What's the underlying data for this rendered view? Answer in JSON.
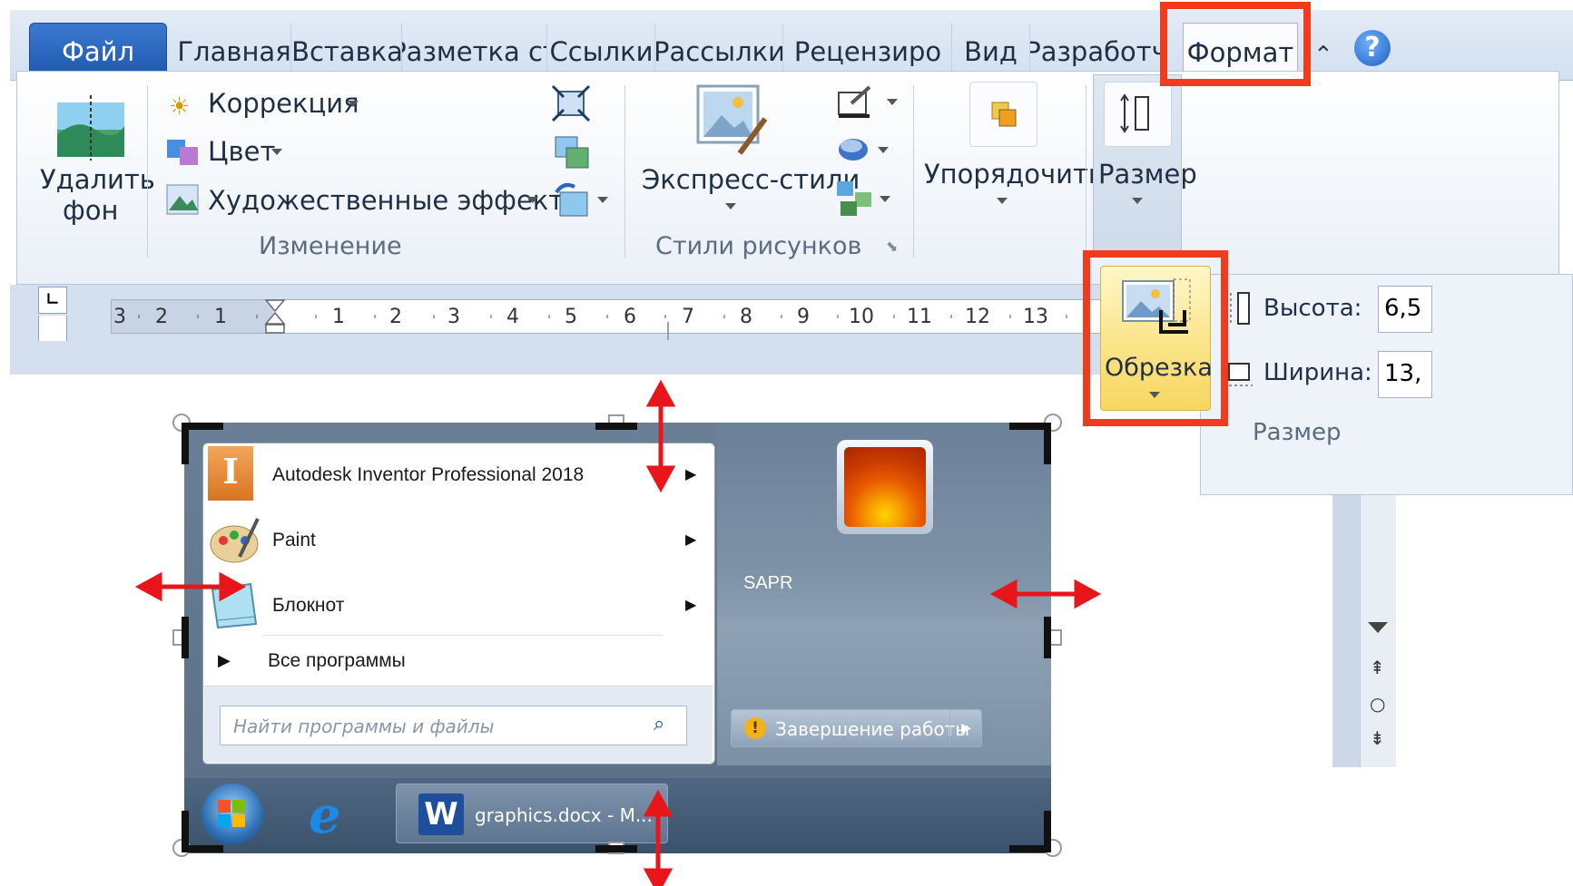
{
  "tabs": {
    "file": "Файл",
    "home": "Главная",
    "insert": "Вставка",
    "layout": "Разметка ст",
    "references": "Ссылки",
    "mailings": "Рассылки",
    "review": "Рецензиро",
    "view": "Вид",
    "developer": "Разработч",
    "format": "Формат"
  },
  "ribbon": {
    "remove_bg_line1": "Удалить",
    "remove_bg_line2": "фон",
    "correction": "Коррекция",
    "color": "Цвет",
    "artistic_effects": "Художественные эффекты",
    "group_adjust": "Изменение",
    "quick_styles": "Экспресс-стили",
    "group_picture_styles": "Стили рисунков",
    "arrange": "Упорядочить",
    "size": "Размер"
  },
  "ruler": {
    "numbers": [
      "3",
      "2",
      "1",
      "1",
      "2",
      "3",
      "4",
      "5",
      "6",
      "7",
      "8",
      "9",
      "10",
      "11",
      "12",
      "13"
    ]
  },
  "size_popout": {
    "crop": "Обрезка",
    "height_label": "Высота:",
    "height_value": "6,5",
    "width_label": "Ширина:",
    "width_value": "13,",
    "group_label": "Размер"
  },
  "start_menu": {
    "items": [
      {
        "label": "Autodesk Inventor Professional 2018"
      },
      {
        "label": "Paint"
      },
      {
        "label": "Блокнот"
      }
    ],
    "all_programs": "Все программы",
    "search_placeholder": "Найти программы и файлы",
    "user": "SAPR",
    "shutdown": "Завершение работы",
    "taskbar_word": "graphics.docx - M..."
  },
  "colors": {
    "highlight_red": "#f23a1d",
    "arrow_red": "#e8161b",
    "file_tab_blue": "#2a66be"
  }
}
